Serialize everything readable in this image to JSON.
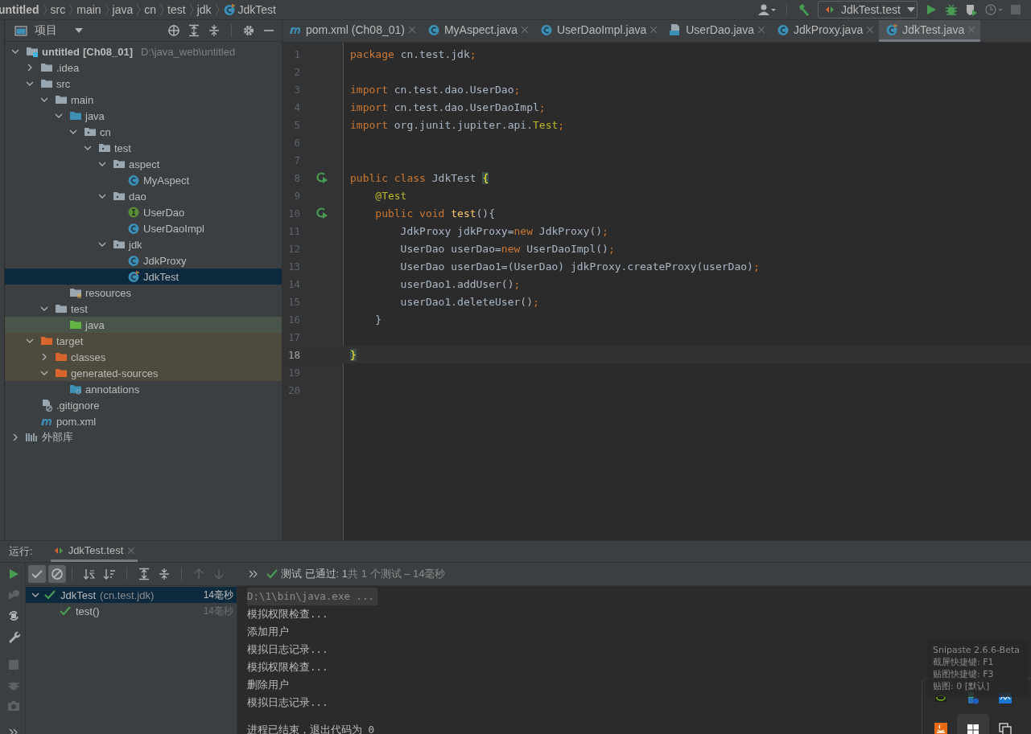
{
  "breadcrumb": [
    {
      "label": "untitled",
      "kind": "project"
    },
    {
      "label": "src",
      "kind": "dir"
    },
    {
      "label": "main",
      "kind": "dir"
    },
    {
      "label": "java",
      "kind": "dir"
    },
    {
      "label": "cn",
      "kind": "dir"
    },
    {
      "label": "test",
      "kind": "dir"
    },
    {
      "label": "jdk",
      "kind": "dir"
    },
    {
      "label": "JdkTest",
      "kind": "test-class"
    }
  ],
  "toolbar": {
    "run_config": "JdkTest.test"
  },
  "project_panel": {
    "title": "项目",
    "tree": [
      {
        "name": "untitled",
        "module": "[Ch08_01]",
        "path": "D:\\java_web\\untitled",
        "kind": "module",
        "expanded": true,
        "selected": false,
        "children": [
          {
            "name": ".idea",
            "kind": "folder",
            "expanded": false,
            "selected": false
          },
          {
            "name": "src",
            "kind": "folder",
            "expanded": true,
            "selected": false,
            "children": [
              {
                "name": "main",
                "kind": "folder",
                "expanded": true,
                "selected": false,
                "children": [
                  {
                    "name": "java",
                    "kind": "source-root",
                    "expanded": true,
                    "selected": false,
                    "children": [
                      {
                        "name": "cn",
                        "kind": "package",
                        "expanded": true,
                        "selected": false,
                        "children": [
                          {
                            "name": "test",
                            "kind": "package",
                            "expanded": true,
                            "selected": false,
                            "children": [
                              {
                                "name": "aspect",
                                "kind": "package",
                                "expanded": true,
                                "selected": false,
                                "children": [
                                  {
                                    "name": "MyAspect",
                                    "kind": "class",
                                    "selected": false
                                  }
                                ]
                              },
                              {
                                "name": "dao",
                                "kind": "package",
                                "expanded": true,
                                "selected": false,
                                "children": [
                                  {
                                    "name": "UserDao",
                                    "kind": "interface",
                                    "selected": false
                                  },
                                  {
                                    "name": "UserDaoImpl",
                                    "kind": "class",
                                    "selected": false
                                  }
                                ]
                              },
                              {
                                "name": "jdk",
                                "kind": "package",
                                "expanded": true,
                                "selected": false,
                                "children": [
                                  {
                                    "name": "JdkProxy",
                                    "kind": "class",
                                    "selected": false
                                  },
                                  {
                                    "name": "JdkTest",
                                    "kind": "test-class",
                                    "selected": true
                                  }
                                ]
                              }
                            ]
                          }
                        ]
                      }
                    ]
                  },
                  {
                    "name": "resources",
                    "kind": "resources",
                    "selected": false
                  }
                ]
              },
              {
                "name": "test",
                "kind": "folder",
                "expanded": true,
                "selected": false,
                "children": [
                  {
                    "name": "java",
                    "kind": "test-root",
                    "selected": false
                  }
                ]
              }
            ]
          },
          {
            "name": "target",
            "kind": "excluded",
            "expanded": true,
            "selected": false,
            "children": [
              {
                "name": "classes",
                "kind": "excluded",
                "expanded": false,
                "selected": false
              },
              {
                "name": "generated-sources",
                "kind": "excluded",
                "expanded": true,
                "selected": false,
                "children": [
                  {
                    "name": "annotations",
                    "kind": "generated",
                    "selected": false
                  }
                ]
              }
            ]
          },
          {
            "name": ".gitignore",
            "kind": "gitignore",
            "selected": false
          },
          {
            "name": "pom.xml",
            "kind": "maven",
            "selected": false
          }
        ]
      },
      {
        "name": "外部库",
        "kind": "library",
        "expanded": false,
        "selected": false
      }
    ]
  },
  "tabs": [
    {
      "label": "pom.xml (Ch08_01)",
      "kind": "maven",
      "selected": false
    },
    {
      "label": "MyAspect.java",
      "kind": "class",
      "selected": false
    },
    {
      "label": "UserDaoImpl.java",
      "kind": "class",
      "selected": false
    },
    {
      "label": "UserDao.java",
      "kind": "file",
      "selected": false
    },
    {
      "label": "JdkProxy.java",
      "kind": "class",
      "selected": false
    },
    {
      "label": "JdkTest.java",
      "kind": "test-class",
      "selected": true
    }
  ],
  "editor": {
    "lines": [
      {
        "no": "1",
        "current": false,
        "run_marker": false,
        "tokens": [
          {
            "t": "package ",
            "kind": "kw"
          },
          {
            "t": "cn.test.jdk",
            "kind": "plain"
          },
          {
            "t": ";",
            "kind": "punct"
          }
        ]
      },
      {
        "no": "2",
        "current": false,
        "run_marker": false
      },
      {
        "no": "3",
        "current": false,
        "run_marker": false,
        "tokens": [
          {
            "t": "import ",
            "kind": "kw"
          },
          {
            "t": "cn.test.dao.UserDao",
            "kind": "plain"
          },
          {
            "t": ";",
            "kind": "punct"
          }
        ]
      },
      {
        "no": "4",
        "current": false,
        "run_marker": false,
        "tokens": [
          {
            "t": "import ",
            "kind": "kw"
          },
          {
            "t": "cn.test.dao.UserDaoImpl",
            "kind": "plain"
          },
          {
            "t": ";",
            "kind": "punct"
          }
        ]
      },
      {
        "no": "5",
        "current": false,
        "run_marker": false,
        "tokens": [
          {
            "t": "import ",
            "kind": "kw"
          },
          {
            "t": "org.junit.jupiter.api.",
            "kind": "plain"
          },
          {
            "t": "Test",
            "kind": "ann"
          },
          {
            "t": ";",
            "kind": "punct"
          }
        ]
      },
      {
        "no": "6",
        "current": false,
        "run_marker": false
      },
      {
        "no": "7",
        "current": false,
        "run_marker": false
      },
      {
        "no": "8",
        "current": false,
        "run_marker": true,
        "tokens": [
          {
            "t": "public class ",
            "kind": "kw"
          },
          {
            "t": "JdkTest ",
            "kind": "plain"
          },
          {
            "t": "{",
            "kind": "brace"
          }
        ]
      },
      {
        "no": "9",
        "current": false,
        "run_marker": false,
        "tokens": [
          {
            "t": "    @Test",
            "kind": "ann"
          }
        ]
      },
      {
        "no": "10",
        "current": false,
        "run_marker": true,
        "tokens": [
          {
            "t": "    public void ",
            "kind": "kw"
          },
          {
            "t": "test",
            "kind": "method"
          },
          {
            "t": "(){",
            "kind": "plain"
          }
        ]
      },
      {
        "no": "11",
        "current": false,
        "run_marker": false,
        "tokens": [
          {
            "t": "        JdkProxy jdkProxy=",
            "kind": "plain"
          },
          {
            "t": "new ",
            "kind": "kw"
          },
          {
            "t": "JdkProxy()",
            "kind": "plain"
          },
          {
            "t": ";",
            "kind": "punct"
          }
        ]
      },
      {
        "no": "12",
        "current": false,
        "run_marker": false,
        "tokens": [
          {
            "t": "        UserDao userDao=",
            "kind": "plain"
          },
          {
            "t": "new ",
            "kind": "kw"
          },
          {
            "t": "UserDaoImpl()",
            "kind": "plain"
          },
          {
            "t": ";",
            "kind": "punct"
          }
        ]
      },
      {
        "no": "13",
        "current": false,
        "run_marker": false,
        "tokens": [
          {
            "t": "        UserDao userDao1=(UserDao) jdkProxy.createProxy(userDao)",
            "kind": "plain"
          },
          {
            "t": ";",
            "kind": "punct"
          }
        ]
      },
      {
        "no": "14",
        "current": false,
        "run_marker": false,
        "tokens": [
          {
            "t": "        userDao1.addUser()",
            "kind": "plain"
          },
          {
            "t": ";",
            "kind": "punct"
          }
        ]
      },
      {
        "no": "15",
        "current": false,
        "run_marker": false,
        "tokens": [
          {
            "t": "        userDao1.deleteUser()",
            "kind": "plain"
          },
          {
            "t": ";",
            "kind": "punct"
          }
        ]
      },
      {
        "no": "16",
        "current": false,
        "run_marker": false,
        "tokens": [
          {
            "t": "    }",
            "kind": "plain"
          }
        ]
      },
      {
        "no": "17",
        "current": false,
        "run_marker": false
      },
      {
        "no": "18",
        "current": true,
        "run_marker": false,
        "tokens": [
          {
            "t": "}",
            "kind": "brace"
          }
        ]
      },
      {
        "no": "19",
        "current": false,
        "run_marker": false
      },
      {
        "no": "20",
        "current": false,
        "run_marker": false
      }
    ]
  },
  "run_panel": {
    "label": "运行:",
    "tabs": [
      {
        "label": "JdkTest.test",
        "selected": true
      }
    ],
    "toggles": [
      {
        "kind": "show-passed",
        "on": true
      },
      {
        "kind": "show-ignored",
        "on": true
      }
    ],
    "status": "测试 已通过: 1",
    "status_detail": "共 1 个测试 – 14毫秒",
    "tests": [
      {
        "name": "JdkTest",
        "package": "(cn.test.jdk)",
        "time": "14毫秒",
        "selected": true,
        "expanded": true,
        "children": [
          {
            "name": "test()",
            "time": "14毫秒",
            "selected": false
          }
        ]
      }
    ],
    "console": [
      {
        "text": "D:\\1\\bin\\java.exe ...",
        "kind": "command"
      },
      {
        "text": "模拟权限检查...",
        "kind": "output"
      },
      {
        "text": "添加用户",
        "kind": "output"
      },
      {
        "text": "模拟日志记录...",
        "kind": "output"
      },
      {
        "text": "模拟权限检查...",
        "kind": "output"
      },
      {
        "text": "删除用户",
        "kind": "output"
      },
      {
        "text": "模拟日志记录...",
        "kind": "output"
      },
      {
        "kind": "blank"
      },
      {
        "text": "进程已结束，退出代码为 0",
        "kind": "output"
      }
    ]
  },
  "tooltip": {
    "title": "Snipaste 2.6.6-Beta",
    "lines": [
      "截屏快捷键: F1",
      "贴图快捷键: F3",
      "贴图: 0 [默认]"
    ]
  }
}
